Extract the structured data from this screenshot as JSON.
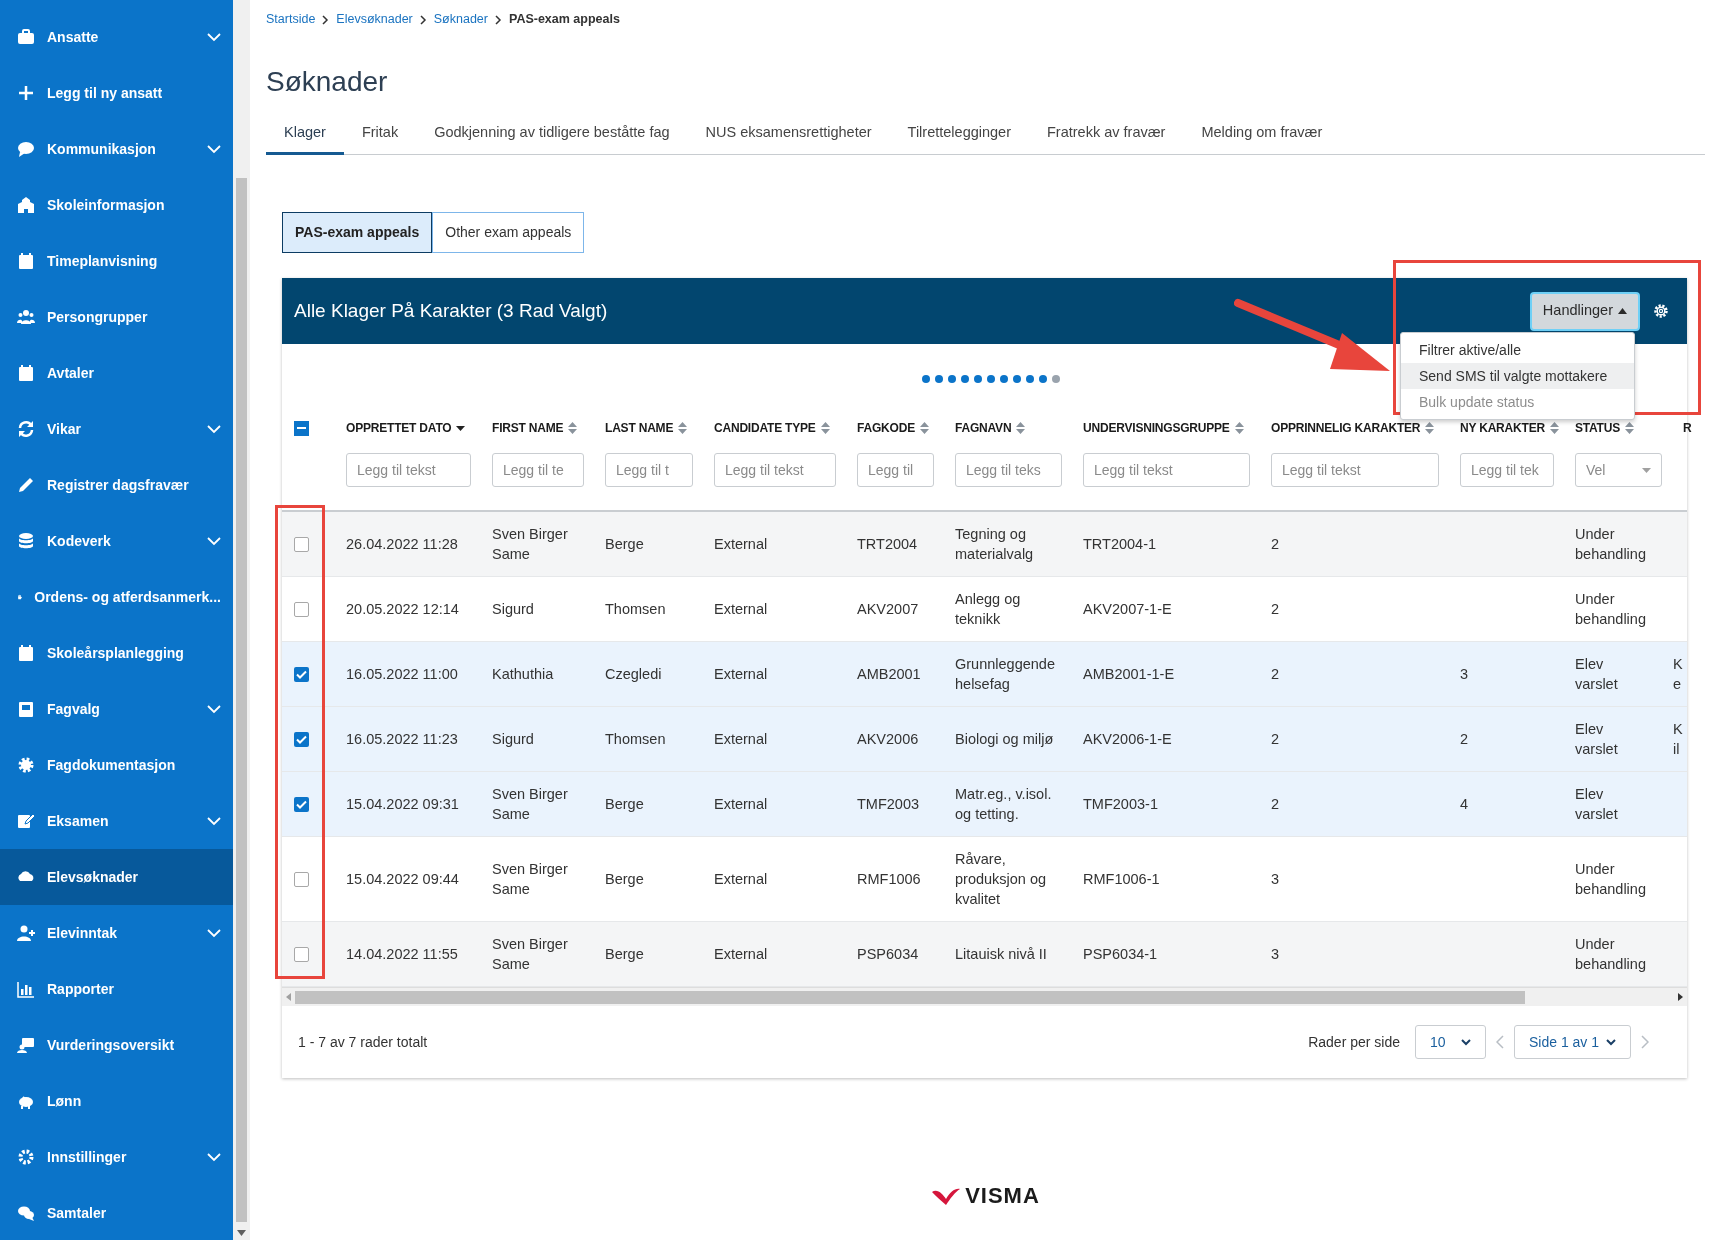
{
  "sidebar": {
    "items": [
      {
        "label": "Ansatte",
        "expandable": true,
        "selected": false
      },
      {
        "label": "Legg til ny ansatt",
        "expandable": false,
        "selected": false
      },
      {
        "label": "Kommunikasjon",
        "expandable": true,
        "selected": false
      },
      {
        "label": "Skoleinformasjon",
        "expandable": false,
        "selected": false
      },
      {
        "label": "Timeplanvisning",
        "expandable": false,
        "selected": false
      },
      {
        "label": "Persongrupper",
        "expandable": false,
        "selected": false
      },
      {
        "label": "Avtaler",
        "expandable": false,
        "selected": false
      },
      {
        "label": "Vikar",
        "expandable": true,
        "selected": false
      },
      {
        "label": "Registrer dagsfravær",
        "expandable": false,
        "selected": false
      },
      {
        "label": "Kodeverk",
        "expandable": true,
        "selected": false
      },
      {
        "label": "Ordens- og atferdsanmerk...",
        "expandable": false,
        "selected": false
      },
      {
        "label": "Skoleårsplanlegging",
        "expandable": false,
        "selected": false
      },
      {
        "label": "Fagvalg",
        "expandable": true,
        "selected": false
      },
      {
        "label": "Fagdokumentasjon",
        "expandable": false,
        "selected": false
      },
      {
        "label": "Eksamen",
        "expandable": true,
        "selected": false
      },
      {
        "label": "Elevsøknader",
        "expandable": false,
        "selected": true
      },
      {
        "label": "Elevinntak",
        "expandable": true,
        "selected": false
      },
      {
        "label": "Rapporter",
        "expandable": false,
        "selected": false
      },
      {
        "label": "Vurderingsoversikt",
        "expandable": false,
        "selected": false
      },
      {
        "label": "Lønn",
        "expandable": false,
        "selected": false
      },
      {
        "label": "Innstillinger",
        "expandable": true,
        "selected": false
      },
      {
        "label": "Samtaler",
        "expandable": false,
        "selected": false
      }
    ]
  },
  "breadcrumb": [
    {
      "label": "Startside",
      "link": true
    },
    {
      "label": "Elevsøknader",
      "link": true
    },
    {
      "label": "Søknader",
      "link": true
    },
    {
      "label": "PAS-exam appeals",
      "link": false
    }
  ],
  "page_title": "Søknader",
  "tabs": [
    {
      "label": "Klager",
      "selected": true
    },
    {
      "label": "Fritak",
      "selected": false
    },
    {
      "label": "Godkjenning av tidligere beståtte fag",
      "selected": false
    },
    {
      "label": "NUS eksamensrettigheter",
      "selected": false
    },
    {
      "label": "Tilrettelegginger",
      "selected": false
    },
    {
      "label": "Fratrekk av fravær",
      "selected": false
    },
    {
      "label": "Melding om fravær",
      "selected": false
    }
  ],
  "subtabs": [
    {
      "label": "PAS-exam appeals",
      "selected": true
    },
    {
      "label": "Other exam appeals",
      "selected": false
    }
  ],
  "table_card": {
    "title": "Alle Klager På Karakter (3 Rad Valgt)",
    "actions_button": "Handlinger",
    "actions_menu": [
      {
        "label": "Filtrer aktive/alle",
        "hovered": false,
        "disabled": false
      },
      {
        "label": "Send SMS til valgte mottakere",
        "hovered": true,
        "disabled": false
      },
      {
        "label": "Bulk update status",
        "hovered": false,
        "disabled": true
      }
    ],
    "select_all": {
      "indeterminate": true
    },
    "columns": [
      {
        "label": "OPPRETTET DATO",
        "sorted_desc": true,
        "filter": {
          "kind": "text",
          "placeholder": "Legg til tekst"
        }
      },
      {
        "label": "FIRST NAME",
        "sorted_desc": false,
        "filter": {
          "kind": "text",
          "placeholder": "Legg til te"
        }
      },
      {
        "label": "LAST NAME",
        "sorted_desc": false,
        "filter": {
          "kind": "text",
          "placeholder": "Legg til t"
        }
      },
      {
        "label": "CANDIDATE TYPE",
        "sorted_desc": false,
        "filter": {
          "kind": "text",
          "placeholder": "Legg til tekst"
        }
      },
      {
        "label": "FAGKODE",
        "sorted_desc": false,
        "filter": {
          "kind": "text",
          "placeholder": "Legg til"
        }
      },
      {
        "label": "FAGNAVN",
        "sorted_desc": false,
        "filter": {
          "kind": "text",
          "placeholder": "Legg til teks"
        }
      },
      {
        "label": "UNDERVISNINGSGRUPPE",
        "sorted_desc": false,
        "filter": {
          "kind": "text",
          "placeholder": "Legg til tekst"
        }
      },
      {
        "label": "OPPRINNELIG KARAKTER",
        "sorted_desc": false,
        "filter": {
          "kind": "text",
          "placeholder": "Legg til tekst"
        }
      },
      {
        "label": "NY KARAKTER",
        "sorted_desc": false,
        "filter": {
          "kind": "text",
          "placeholder": "Legg til tek"
        }
      },
      {
        "label": "STATUS",
        "sorted_desc": false,
        "filter": {
          "kind": "select",
          "placeholder": "Vel"
        }
      },
      {
        "label": "R"
      }
    ],
    "rows": [
      {
        "selected": false,
        "cells": [
          "26.04.2022 11:28",
          "Sven Birger Same",
          "Berge",
          "External",
          "TRT2004",
          "Tegning og materialvalg",
          "TRT2004-1",
          "2",
          null,
          "Under behandling",
          null
        ]
      },
      {
        "selected": false,
        "cells": [
          "20.05.2022 12:14",
          "Sigurd",
          "Thomsen",
          "External",
          "AKV2007",
          "Anlegg og teknikk",
          "AKV2007-1-E",
          "2",
          null,
          "Under behandling",
          null
        ]
      },
      {
        "selected": true,
        "cells": [
          "16.05.2022 11:00",
          "Kathuthia",
          "Czegledi",
          "External",
          "AMB2001",
          "Grunnleggende helsefag",
          "AMB2001-1-E",
          "2",
          "3",
          "Elev varslet",
          "K e"
        ]
      },
      {
        "selected": true,
        "cells": [
          "16.05.2022 11:23",
          "Sigurd",
          "Thomsen",
          "External",
          "AKV2006",
          "Biologi og miljø",
          "AKV2006-1-E",
          "2",
          "2",
          "Elev varslet",
          "K il"
        ]
      },
      {
        "selected": true,
        "cells": [
          "15.04.2022 09:31",
          "Sven Birger Same",
          "Berge",
          "External",
          "TMF2003",
          "Matr.eg., v.isol. og tetting.",
          "TMF2003-1",
          "2",
          "4",
          "Elev varslet",
          null
        ]
      },
      {
        "selected": false,
        "cells": [
          "15.04.2022 09:44",
          "Sven Birger Same",
          "Berge",
          "External",
          "RMF1006",
          "Råvare, produksjon og kvalitet",
          "RMF1006-1",
          "3",
          null,
          "Under behandling",
          null
        ]
      },
      {
        "selected": false,
        "cells": [
          "14.04.2022 11:55",
          "Sven Birger Same",
          "Berge",
          "External",
          "PSP6034",
          "Litauisk nivå II",
          "PSP6034-1",
          "3",
          null,
          "Under behandling",
          null
        ]
      }
    ],
    "footer": {
      "total": "1 - 7 av 7 rader totalt",
      "per_page_label": "Rader per side",
      "per_page": "10",
      "page": "Side 1 av 1"
    }
  },
  "logo": {
    "text": "VISMA"
  }
}
